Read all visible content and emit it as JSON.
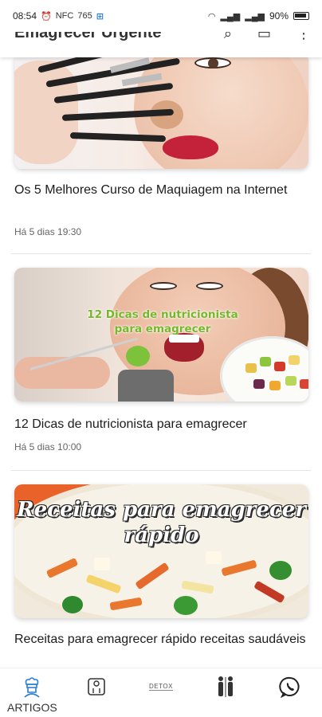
{
  "status_bar": {
    "time": "08:54",
    "nfc": "NFC",
    "speed": "765",
    "battery": "90%"
  },
  "app_bar": {
    "title": "Emagrecer Urgente"
  },
  "articles": [
    {
      "title": "Os 5 Melhores Curso de Maquiagem na Internet",
      "date": "Há 5 dias 19:30",
      "image_icon": "makeup-brushes-woman-image"
    },
    {
      "title": "12 Dicas de nutricionista para emagrecer",
      "date": "Há 5 dias 10:00",
      "image_icon": "woman-eating-salad-image",
      "image_overlay": "12 Dicas de nutricionista para emagrecer"
    },
    {
      "title": "Receitas para emagrecer rápido receitas saudáveis",
      "image_icon": "pasta-salad-image",
      "image_overlay": "Receitas para emagrecer rápido"
    }
  ],
  "bottom_nav": {
    "items": [
      {
        "label": "ARTIGOS",
        "icon": "chef-icon"
      },
      {
        "label": "",
        "icon": "scale-icon"
      },
      {
        "label": "",
        "icon": "detox-icon",
        "icon_text": "DETOX"
      },
      {
        "label": "",
        "icon": "body-compare-icon"
      },
      {
        "label": "",
        "icon": "whatsapp-icon"
      }
    ]
  },
  "colors": {
    "accent_blue": "#2a7fd4",
    "overlay_green": "#76b82a",
    "lips_red": "#c4213a"
  }
}
